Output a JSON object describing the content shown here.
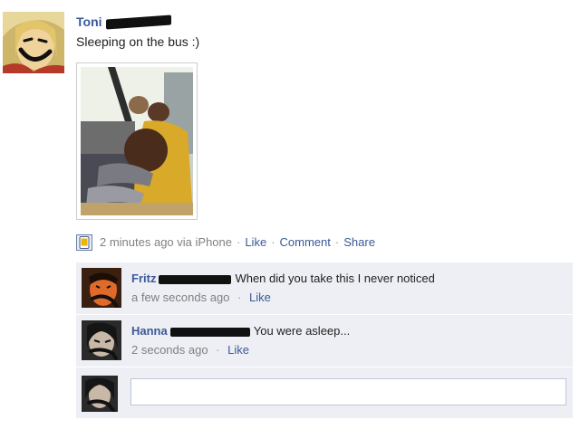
{
  "post": {
    "author": "Toni",
    "text": "Sleeping on the bus :)",
    "avatar_icon": "profile-photo",
    "photo_icon": "photo-sleeping-on-bus",
    "meta": {
      "time": "2 minutes ago via iPhone",
      "app_icon": "iphone-app-icon",
      "like": "Like",
      "comment": "Comment",
      "share": "Share",
      "separator": "·"
    }
  },
  "comments": [
    {
      "author": "Fritz",
      "text": "When did you take this I never noticed",
      "time": "a few seconds ago",
      "like": "Like",
      "separator": "·",
      "avatar_icon": "profile-photo"
    },
    {
      "author": "Hanna",
      "text": "You were asleep...",
      "time": "2 seconds ago",
      "like": "Like",
      "separator": "·",
      "avatar_icon": "profile-photo"
    }
  ],
  "composer": {
    "placeholder": "",
    "avatar_icon": "profile-photo"
  },
  "colors": {
    "link": "#3b5998",
    "meta_gray": "#808080",
    "comment_bg": "#edeff4",
    "redaction": "#111111"
  }
}
